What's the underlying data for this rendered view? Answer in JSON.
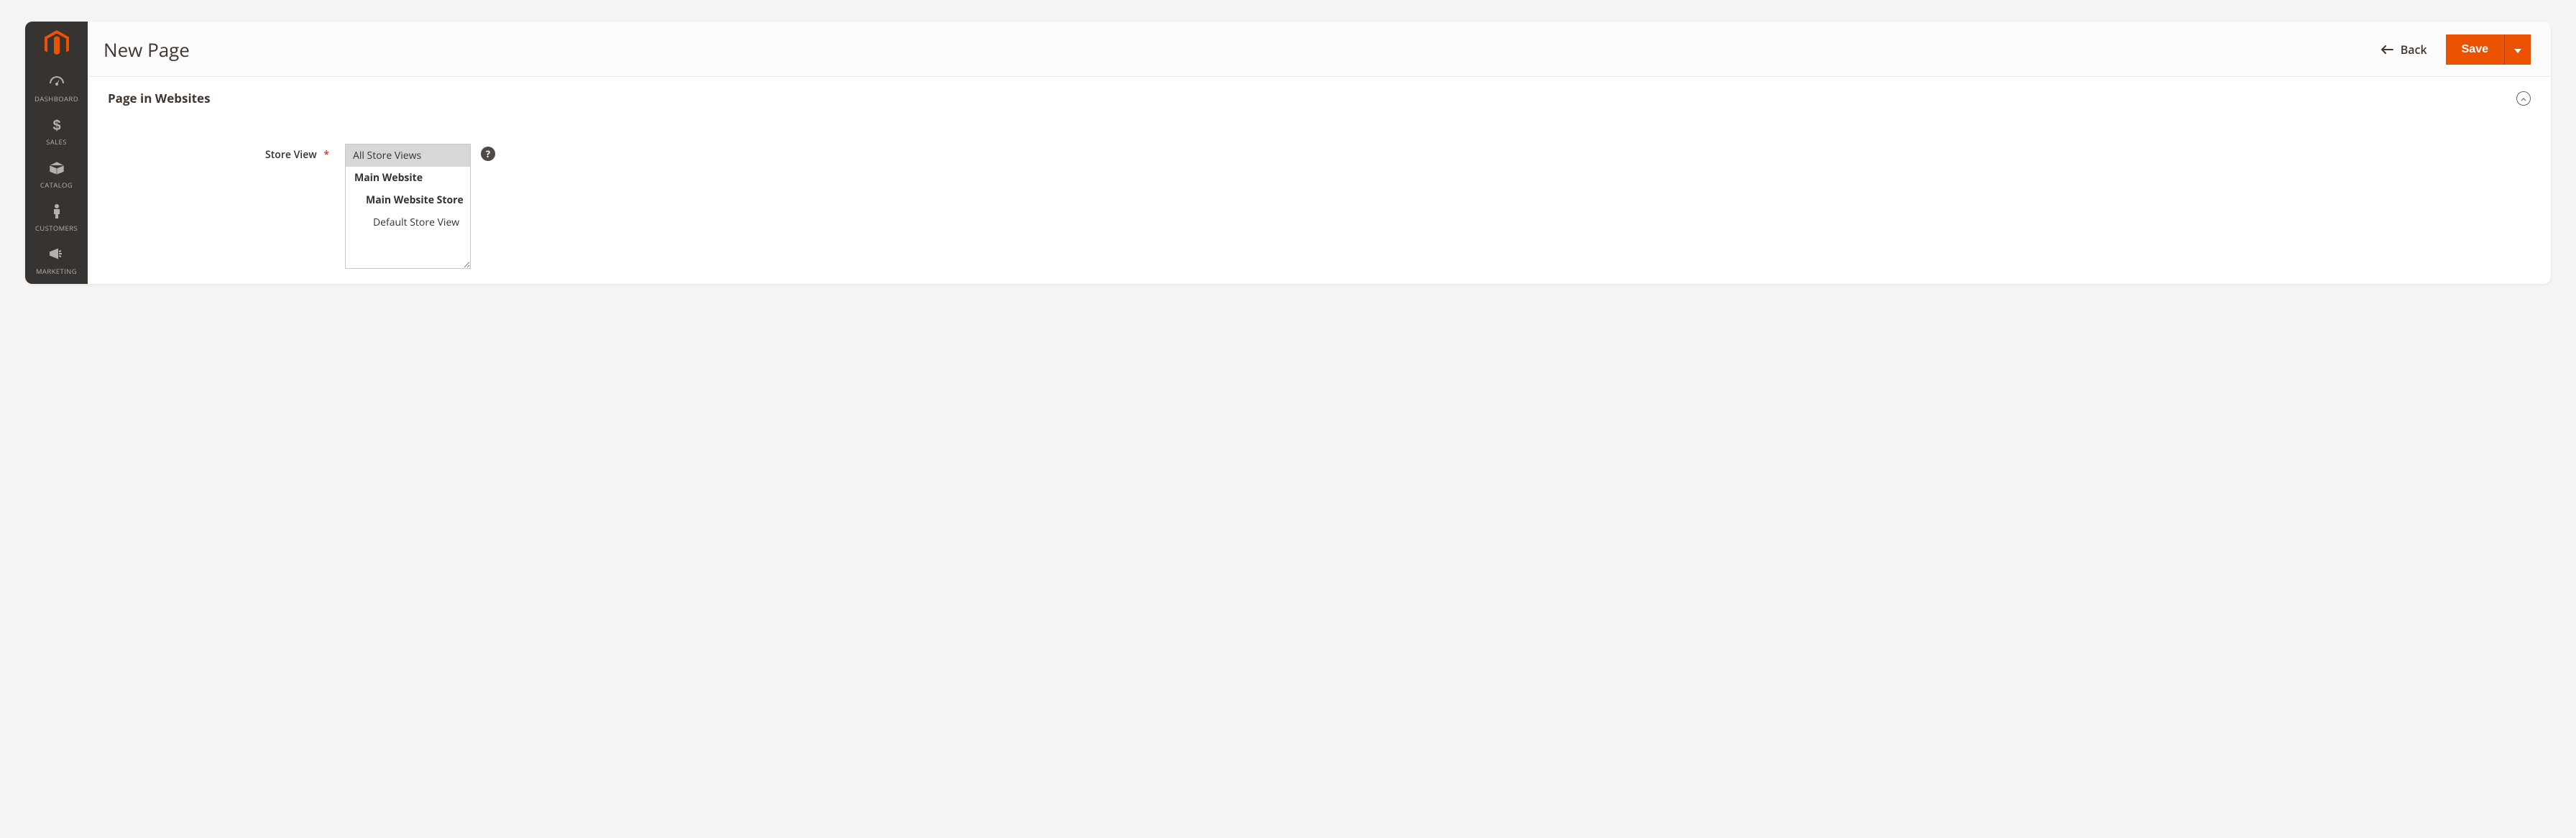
{
  "sidebar": {
    "items": [
      {
        "label": "DASHBOARD",
        "icon": "dashboard-icon"
      },
      {
        "label": "SALES",
        "icon": "dollar-icon"
      },
      {
        "label": "CATALOG",
        "icon": "box-icon"
      },
      {
        "label": "CUSTOMERS",
        "icon": "person-icon"
      },
      {
        "label": "MARKETING",
        "icon": "megaphone-icon"
      }
    ]
  },
  "header": {
    "title": "New Page",
    "back_label": "Back",
    "save_label": "Save"
  },
  "section": {
    "title": "Page in Websites"
  },
  "form": {
    "store_view_label": "Store View",
    "store_view_options": {
      "all": "All Store Views",
      "website": "Main Website",
      "store": "Main Website Store",
      "view": "Default Store View"
    },
    "selected": "All Store Views"
  },
  "help_tooltip": "?"
}
